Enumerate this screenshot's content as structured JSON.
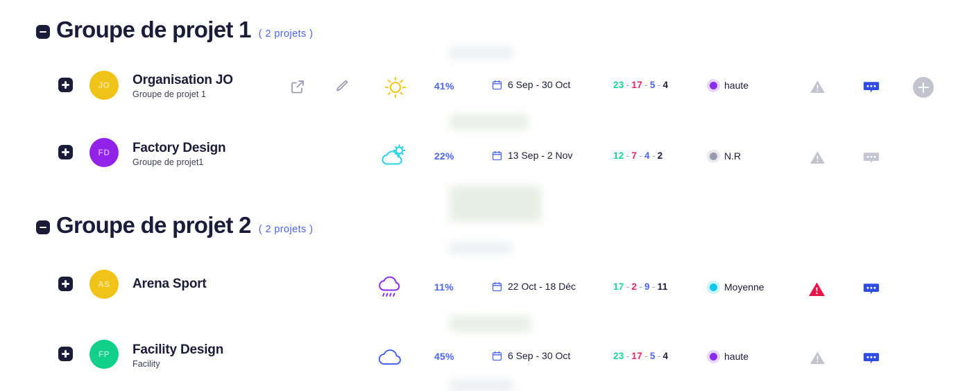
{
  "groups": [
    {
      "id": "group-1",
      "title": "Groupe de projet 1",
      "count_label": "( 2 projets )",
      "toggle_icon": "minus-icon",
      "projects": [
        {
          "id": "organisation-jo",
          "name": "Organisation JO",
          "subtitle": "Groupe de projet 1",
          "avatar_initials": "JO",
          "avatar_color": "#f0c319",
          "expand_icon": "plus-icon",
          "actions": [
            "external-link-icon",
            "pencil-icon"
          ],
          "weather_icon": "sun-icon",
          "weather_color": "#f5c518",
          "progress": "41%",
          "date_range": "6 Sep - 30 Oct",
          "counts": [
            "23",
            "17",
            "5",
            "4"
          ],
          "priority_label": "haute",
          "priority_color": "#8b2df0",
          "alert_icon": "warning-triangle-icon",
          "alert_state": "muted",
          "comment_icon": "comment-bubble-icon",
          "comment_state": "active",
          "has_add_button": true
        },
        {
          "id": "factory-design",
          "name": "Factory Design",
          "subtitle": "Groupe de projet1",
          "avatar_initials": "FD",
          "avatar_color": "#9322e8",
          "expand_icon": "plus-icon",
          "actions": [],
          "weather_icon": "partly-cloudy-icon",
          "weather_color": "#2ad2e8",
          "progress": "22%",
          "date_range": "13 Sep - 2 Nov",
          "counts": [
            "12",
            "7",
            "4",
            "2"
          ],
          "priority_label": "N.R",
          "priority_color": "#9a9ab0",
          "alert_icon": "warning-triangle-icon",
          "alert_state": "muted",
          "comment_icon": "comment-bubble-icon",
          "comment_state": "muted",
          "has_add_button": false
        }
      ]
    },
    {
      "id": "group-2",
      "title": "Groupe de projet 2",
      "count_label": "( 2 projets )",
      "toggle_icon": "minus-icon",
      "projects": [
        {
          "id": "arena-sport",
          "name": "Arena Sport",
          "subtitle": "",
          "avatar_initials": "AS",
          "avatar_color": "#f0c319",
          "expand_icon": "plus-icon",
          "actions": [],
          "weather_icon": "rain-cloud-icon",
          "weather_color": "#8b2df0",
          "progress": "11%",
          "date_range": "22 Oct - 18 Déc",
          "counts": [
            "17",
            "2",
            "9",
            "11"
          ],
          "priority_label": "Moyenne",
          "priority_color": "#10c8f0",
          "alert_icon": "warning-triangle-icon",
          "alert_state": "critical",
          "comment_icon": "comment-bubble-icon",
          "comment_state": "active",
          "has_add_button": false
        },
        {
          "id": "facility-design",
          "name": "Facility Design",
          "subtitle": "Facility",
          "avatar_initials": "FP",
          "avatar_color": "#12cf8a",
          "expand_icon": "plus-icon",
          "actions": [],
          "weather_icon": "cloud-icon",
          "weather_color": "#4a63f5",
          "progress": "45%",
          "date_range": "6 Sep - 30 Oct",
          "counts": [
            "23",
            "17",
            "5",
            "4"
          ],
          "priority_label": "haute",
          "priority_color": "#8b2df0",
          "alert_icon": "warning-triangle-icon",
          "alert_state": "muted",
          "comment_icon": "comment-bubble-icon",
          "comment_state": "active",
          "has_add_button": false
        }
      ]
    }
  ],
  "palette": {
    "accent_blue": "#4a63f5",
    "dark_navy": "#1b1b3a",
    "green": "#16d39a",
    "red": "#e8245c",
    "muted_gray": "#c3c3cf",
    "critical_red": "#e8154a"
  }
}
